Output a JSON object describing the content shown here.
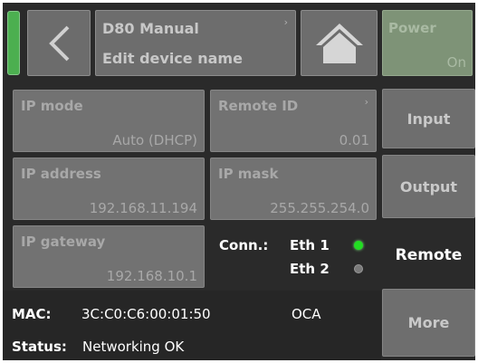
{
  "header": {
    "device_title": "D80 Manual",
    "device_subtitle": "Edit device name",
    "power_label": "Power",
    "power_value": "On"
  },
  "network": {
    "ip_mode_label": "IP mode",
    "ip_mode_value": "Auto (DHCP)",
    "remote_id_label": "Remote ID",
    "remote_id_value": "0.01",
    "ip_address_label": "IP address",
    "ip_address_value": "192.168.11.194",
    "ip_mask_label": "IP mask",
    "ip_mask_value": "255.255.254.0",
    "ip_gateway_label": "IP gateway",
    "ip_gateway_value": "192.168.10.1"
  },
  "connection": {
    "label": "Conn.:",
    "eth1_label": "Eth 1",
    "eth1_color": "#22dd22",
    "eth2_label": "Eth 2",
    "eth2_color": "#7a7a7a"
  },
  "status": {
    "mac_label": "MAC:",
    "mac_value": "3C:C0:C6:00:01:50",
    "protocol": "OCA",
    "status_label": "Status:",
    "status_value": "Networking OK"
  },
  "side_menu": {
    "input": "Input",
    "output": "Output",
    "remote": "Remote",
    "more": "More"
  },
  "colors": {
    "indicator_green": "#4caf50"
  }
}
